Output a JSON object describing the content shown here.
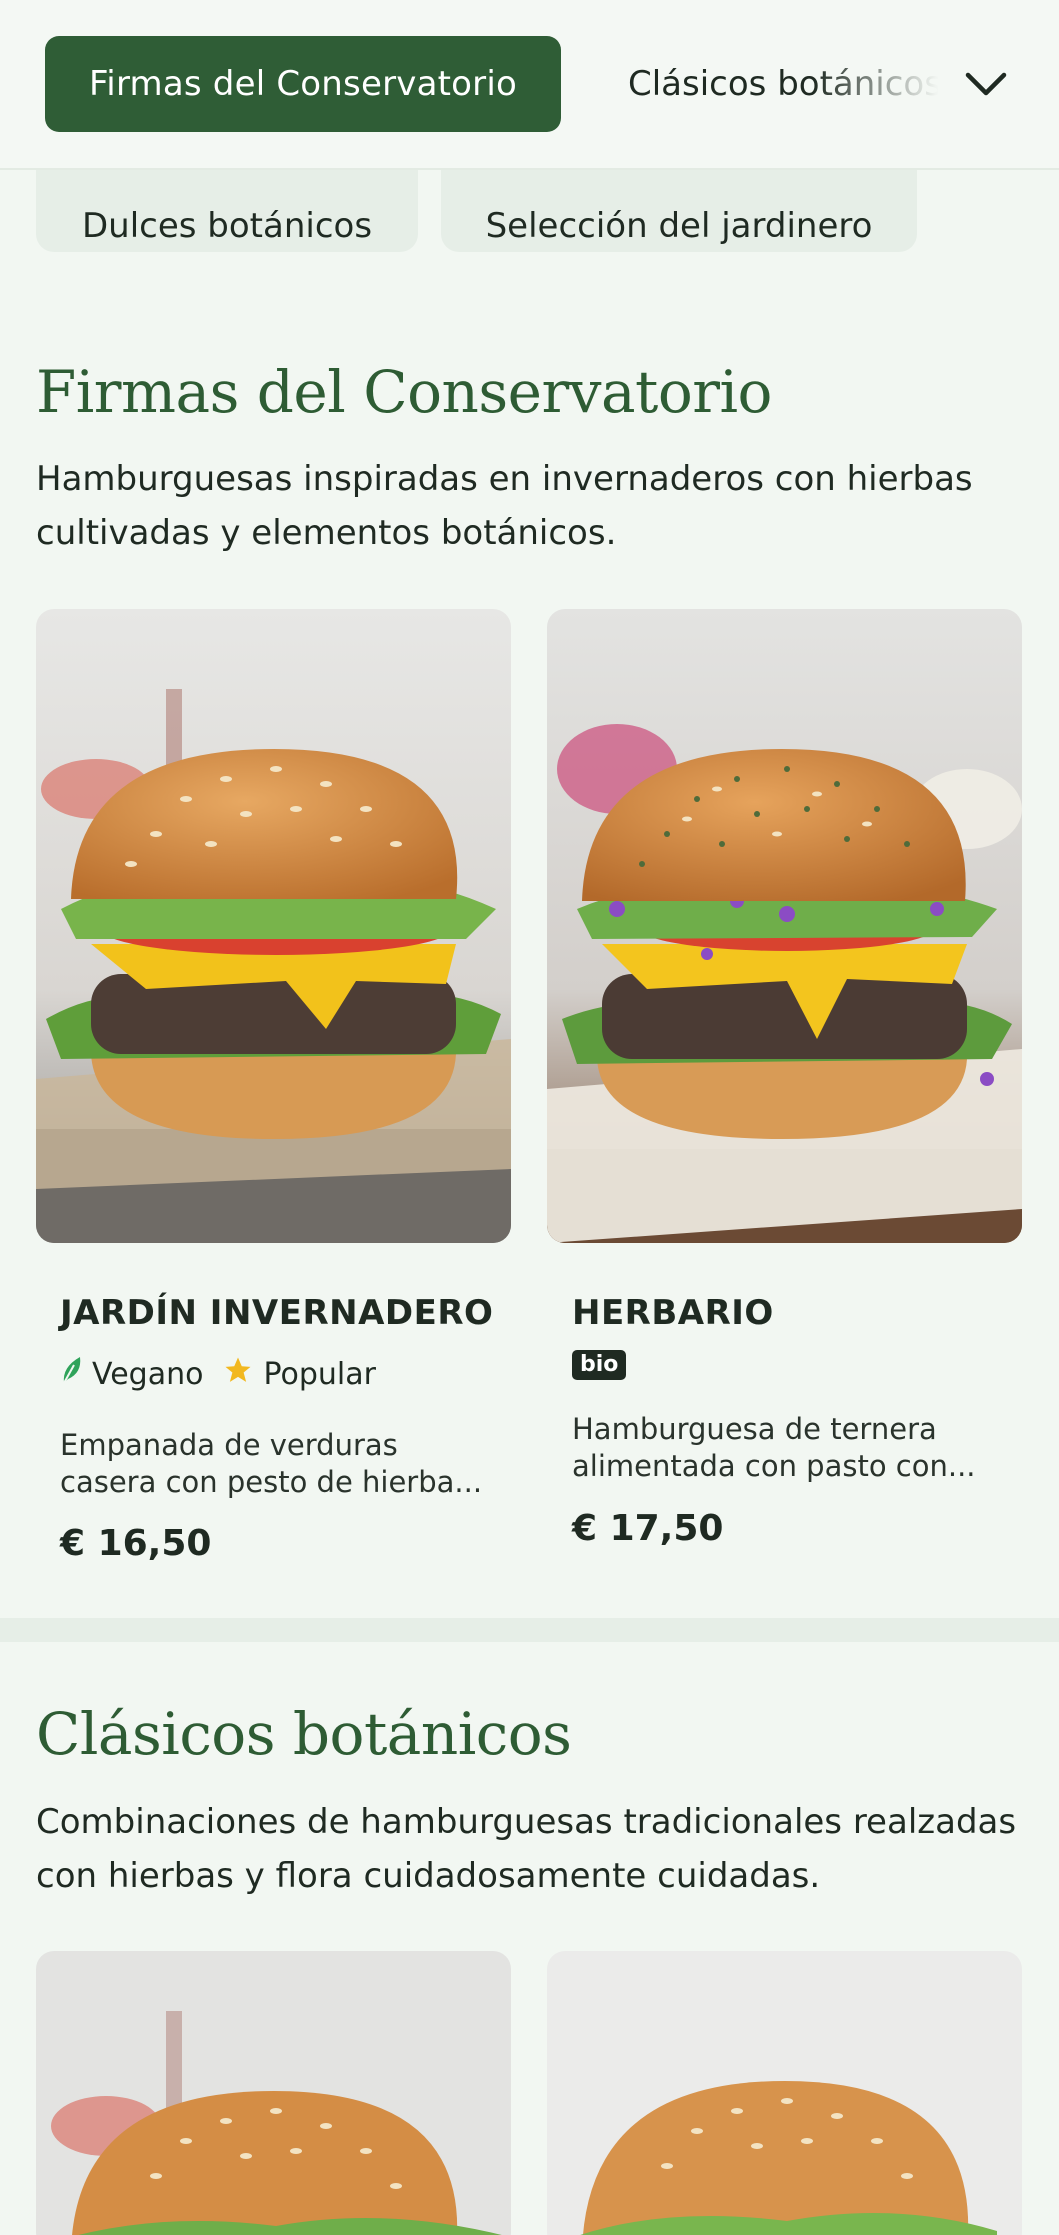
{
  "category_nav": {
    "active": "Firmas del Conservatorio",
    "next": "Clásicos botánicos",
    "chevron_icon": "chevron-down-icon",
    "row2": [
      "Dulces botánicos",
      "Selección del jardinero"
    ]
  },
  "sections": [
    {
      "title": "Firmas del Conservatorio",
      "description": "Hamburguesas inspiradas en invernaderos con hierbas cultivadas y elementos botánicos.",
      "items": [
        {
          "name": "JARDÍN INVERNADERO",
          "tags": [
            {
              "icon": "leaf-icon",
              "label": "Vegano"
            },
            {
              "icon": "star-icon",
              "label": "Popular"
            }
          ],
          "description": "Empanada de verduras casera con pesto de hierba...",
          "price": "€ 16,50"
        },
        {
          "name": "HERBARIO",
          "badge": "bio",
          "description": "Hamburguesa de ternera alimentada con pasto con...",
          "price": "€ 17,50"
        }
      ]
    },
    {
      "title": "Clásicos botánicos",
      "description": "Combinaciones de hamburguesas tradicionales realzadas con hierbas y flora cuidadosamente cuidadas."
    }
  ],
  "colors": {
    "brand_green": "#2f5d36",
    "title_green": "#2e5c34",
    "background": "#f2f7f2",
    "pill_bg": "#e6eee7",
    "vegan_leaf": "#2fa35a",
    "star": "#f2b81f"
  }
}
